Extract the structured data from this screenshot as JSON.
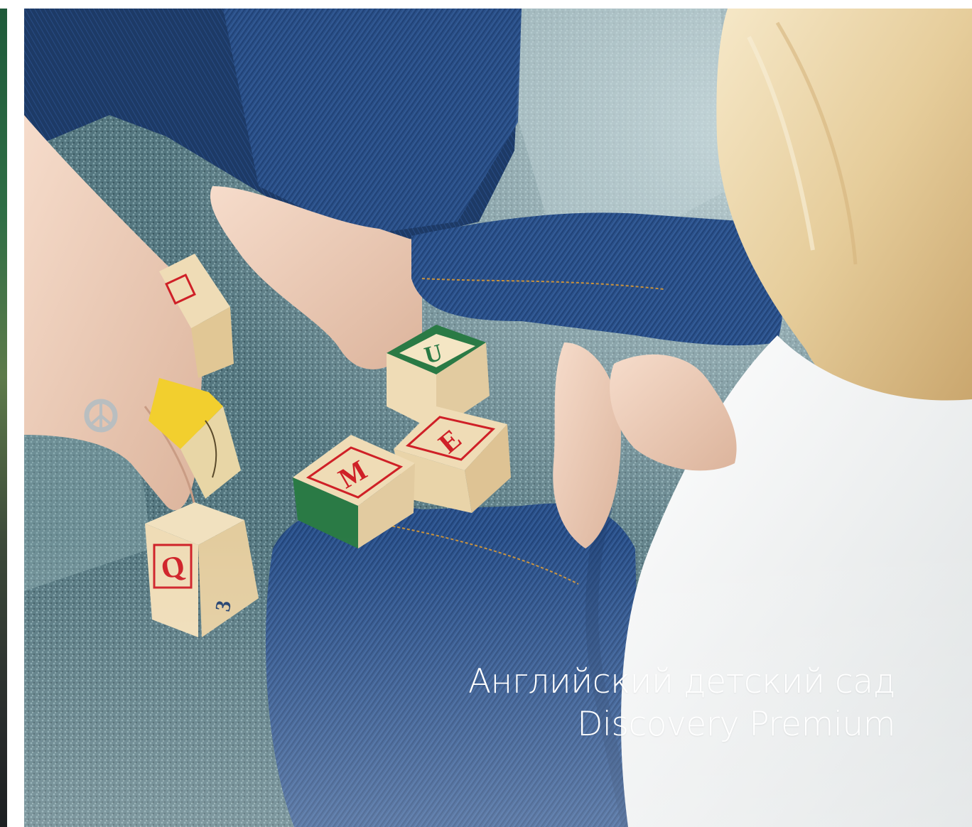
{
  "slider": {
    "slide": {
      "title_line1": "Английский детский сад",
      "title_line2": "Discovery Premium",
      "image_alt": "Ребёнок и взрослый играют с кубиками с буквами"
    },
    "blocks": [
      {
        "letter": "U"
      },
      {
        "letter": "E"
      },
      {
        "letter": "M"
      },
      {
        "letter": "Q"
      },
      {
        "letter": "3"
      }
    ]
  },
  "colors": {
    "carpet": "#52737c",
    "denim": "#2a4e86",
    "white_shirt": "#f2f2f0",
    "hair": "#e8d2a6",
    "skin": "#eed1bd",
    "block_wood": "#efdcb6",
    "letter_red": "#cf2027",
    "border_green": "#2a7a45"
  }
}
